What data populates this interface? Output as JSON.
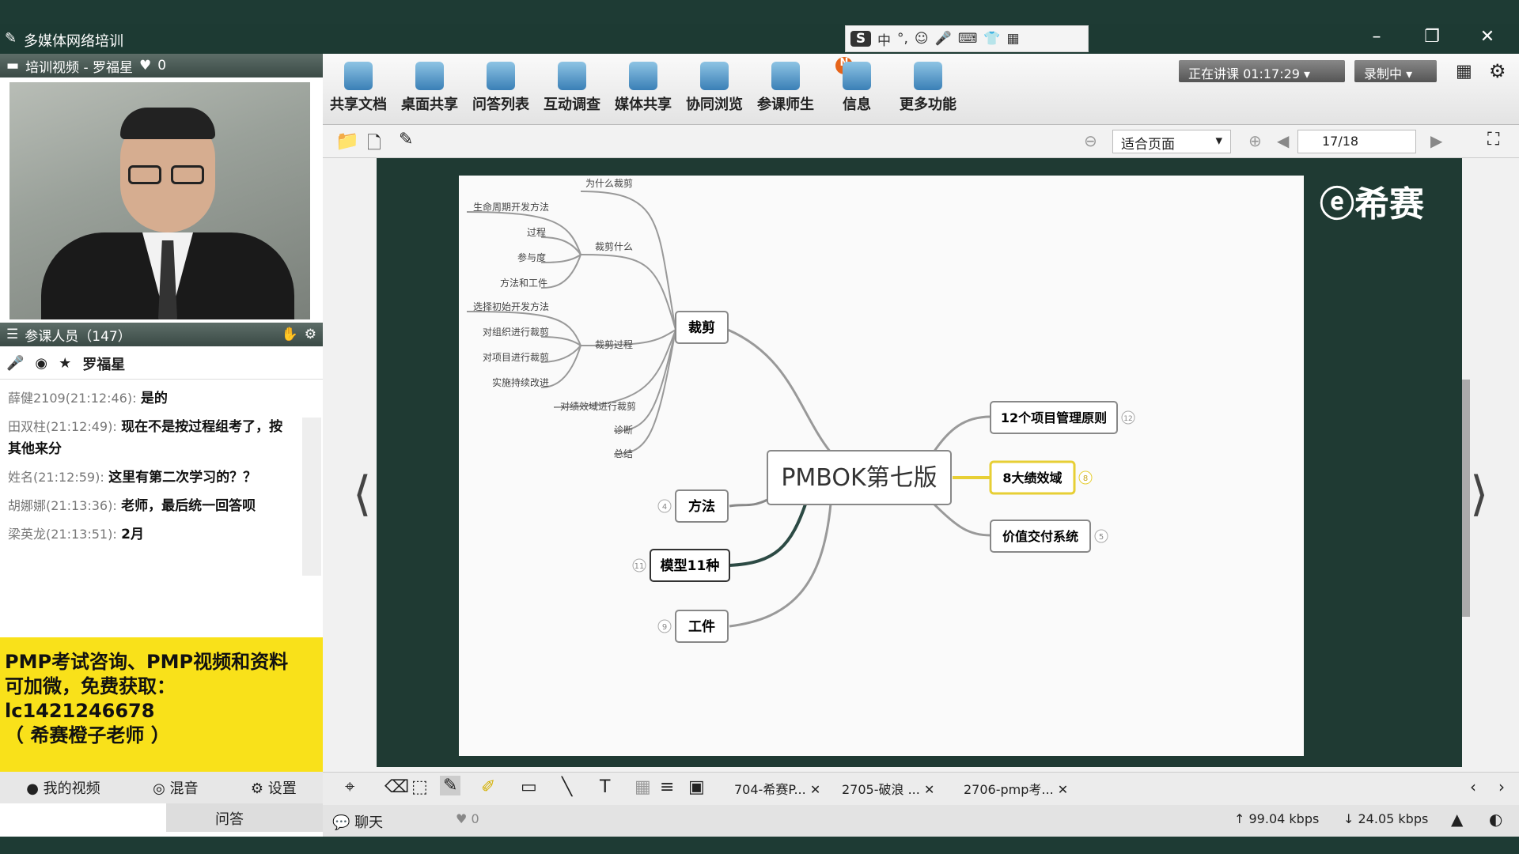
{
  "window": {
    "title": "多媒体网络培训"
  },
  "ime_bar": {
    "items": [
      "中",
      "°,",
      "☺",
      "🎤",
      "⌨",
      "👕",
      "▦"
    ]
  },
  "video_panel": {
    "header": "培训视频 - 罗福星",
    "likes": "0"
  },
  "attendees": {
    "header": "参课人员（147）",
    "presenter": "罗福星"
  },
  "chat": [
    {
      "who": "薛健2109(21:12:46):",
      "text": "是的"
    },
    {
      "who": "田双柱(21:12:49):",
      "text": "现在不是按过程组考了，按其他来分"
    },
    {
      "who": "姓名(21:12:59):",
      "text": "这里有第二次学习的？？"
    },
    {
      "who": "胡娜娜(21:13:36):",
      "text": "老师，最后统一回答呗"
    },
    {
      "who": "梁英龙(21:13:51):",
      "text": "2月"
    }
  ],
  "ad": {
    "lines": [
      "PMP考试咨询、PMP视频和资料",
      "可加微，免费获取：",
      "lc1421246678",
      "（ 希赛橙子老师 ）"
    ]
  },
  "left_bottom": {
    "my_video": "我的视频",
    "mix": "混音",
    "settings": "设置",
    "qa": "问答"
  },
  "toolbar": {
    "tools": [
      "共享文档",
      "桌面共享",
      "问答列表",
      "互动调查",
      "媒体共享",
      "协同浏览",
      "参课师生",
      "信息",
      "更多功能"
    ],
    "badge": "N",
    "lecturing": "正在讲课 01:17:29",
    "recording": "录制中"
  },
  "subbar": {
    "zoom": "适合页面",
    "page": "17/18"
  },
  "slide": {
    "logo": "希赛",
    "center": "PMBOK第七版",
    "branches_left": [
      "裁剪",
      "方法",
      "模型11种",
      "工件"
    ],
    "branches_right": [
      "12个项目管理原则",
      "8大绩效域",
      "价值交付系统"
    ],
    "counts": {
      "method": "4",
      "model": "11",
      "artifact": "9",
      "principles": "12",
      "domains": "8",
      "value": "5"
    },
    "tailor_sub": [
      "为什么裁剪",
      "裁剪什么",
      "裁剪过程",
      "对绩效域进行裁剪",
      "诊断",
      "总结"
    ],
    "what_sub": [
      "生命周期开发方法",
      "过程",
      "参与度",
      "方法和工件"
    ],
    "process_sub": [
      "选择初始开发方法",
      "对组织进行裁剪",
      "对项目进行裁剪",
      "实施持续改进"
    ]
  },
  "tabs": [
    "704-希赛P...",
    "2705-破浪 ...",
    "2706-pmp考..."
  ],
  "status": {
    "chat": "聊天",
    "likes": "0",
    "up": "99.04 kbps",
    "down": "24.05 kbps"
  },
  "colors": {
    "accent_yellow": "#f9e11a",
    "frame_green": "#1e3b34"
  }
}
